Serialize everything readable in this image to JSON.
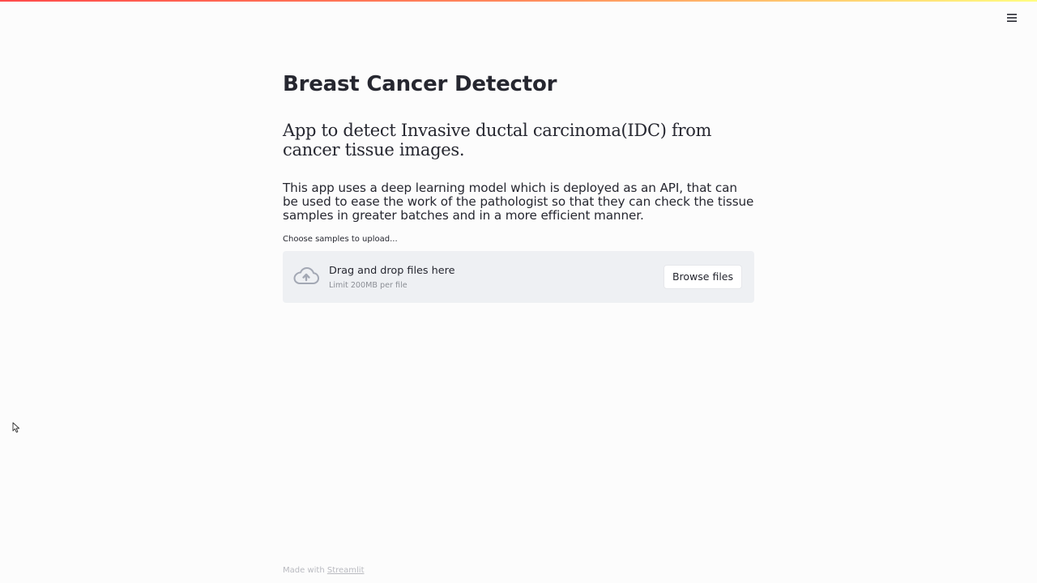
{
  "app": {
    "title": "Breast Cancer Detector",
    "subtitle": "App to detect Invasive ductal carcinoma(IDC) from cancer tissue images.",
    "description": "This app uses a deep learning model which is deployed as an API, that can be used to ease the work of the pathologist so that they can check the tissue samples in greater batches and in a more efficient manner."
  },
  "header": {
    "menu_icon": "hamburger-menu-icon",
    "accent_gradient": [
      "#ff4b4b",
      "#fffd80"
    ]
  },
  "uploader": {
    "label": "Choose samples to upload...",
    "drop_text": "Drag and drop files here",
    "limit_text": "Limit 200MB per file",
    "browse_label": "Browse files",
    "icon": "cloud-upload-icon"
  },
  "footer": {
    "prefix": "Made with ",
    "link_text": "Streamlit"
  }
}
